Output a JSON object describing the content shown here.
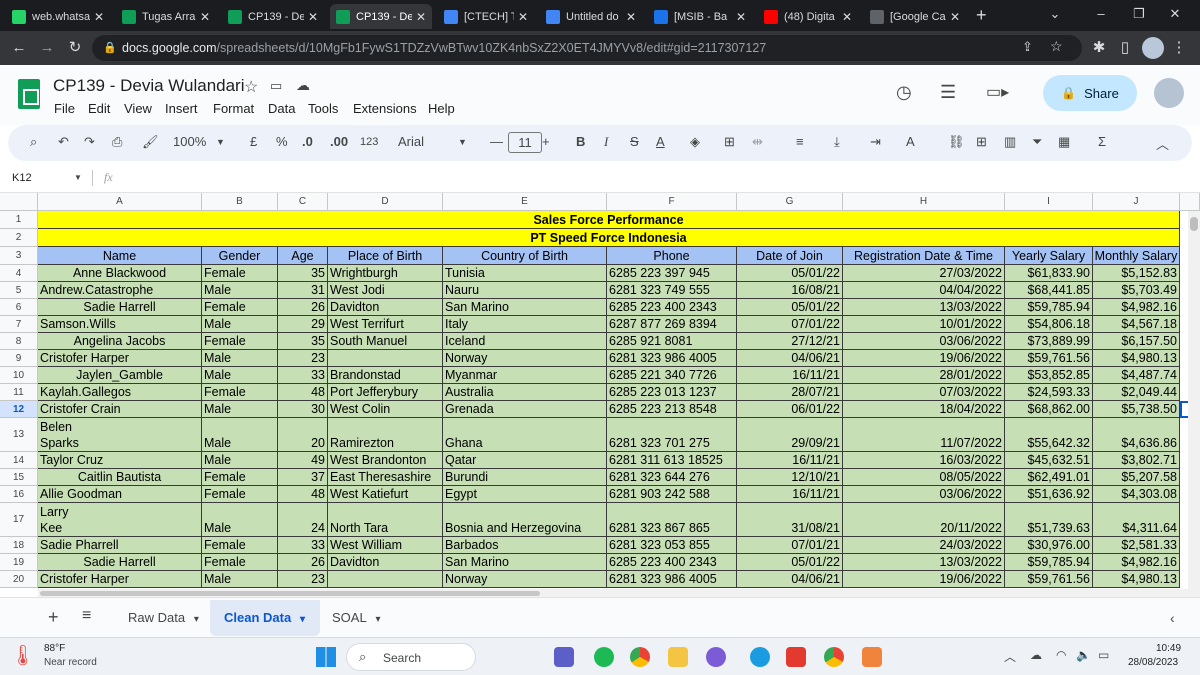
{
  "browser": {
    "tabs": [
      {
        "title": "web.whatsapp",
        "color": "#25d366"
      },
      {
        "title": "Tugas Arra",
        "color": "#0f9d58"
      },
      {
        "title": "CP139 - De",
        "color": "#0f9d58"
      },
      {
        "title": "CP139 - De",
        "color": "#0f9d58"
      },
      {
        "title": "[CTECH] Tu",
        "color": "#4285f4"
      },
      {
        "title": "Untitled do",
        "color": "#4285f4"
      },
      {
        "title": "[MSIB - Ba",
        "color": "#1a73e8"
      },
      {
        "title": "(48) Digita",
        "color": "#ff0000"
      },
      {
        "title": "[Google Ca",
        "color": "#5f6368"
      }
    ],
    "url_host": "docs.google.com",
    "url_path": "/spreadsheets/d/10MgFb1FywS1TDZzVwBTwv10ZK4nbSxZ2X0ET4JMYVv8/edit#gid=2117307127"
  },
  "doc": {
    "title": "CP139 - Devia Wulandari",
    "menu": [
      "File",
      "Edit",
      "View",
      "Insert",
      "Format",
      "Data",
      "Tools",
      "Extensions",
      "Help"
    ],
    "share_label": "Share"
  },
  "toolbar": {
    "zoom": "100%",
    "currency": "£",
    "percent": "%",
    "dec_less": ".0",
    "dec_more": ".00",
    "num_format": "123",
    "font": "Arial",
    "font_size": "11",
    "bold": "B",
    "italic": "I",
    "strike": "S",
    "text_color": "A"
  },
  "formula_bar": {
    "cell_ref": "K12",
    "fx": "fx",
    "value": ""
  },
  "grid": {
    "columns": [
      "A",
      "B",
      "C",
      "D",
      "E",
      "F",
      "G",
      "H",
      "I",
      "J"
    ],
    "row_numbers": [
      "1",
      "2",
      "3",
      "4",
      "5",
      "6",
      "7",
      "8",
      "9",
      "10",
      "11",
      "12",
      "13",
      "14",
      "15",
      "16",
      "17",
      "18",
      "19",
      "20"
    ],
    "banner1": "Sales Force Performance",
    "banner2": "PT Speed Force Indonesia",
    "headers": [
      "Name",
      "Gender",
      "Age",
      "Place of Birth",
      "Country of Birth",
      "Phone",
      "Date of Join",
      "Registration Date & Time",
      "Yearly Salary",
      "Monthly Salary"
    ],
    "rows": [
      [
        "Anne Blackwood",
        "Female",
        "35",
        "Wrightburgh",
        "Tunisia",
        "6285 223 397 945",
        "05/01/22",
        "27/03/2022",
        "$61,833.90",
        "$5,152.83"
      ],
      [
        "Andrew.Catastrophe",
        "Male",
        "31",
        "West Jodi",
        "Nauru",
        "6281 323 749 555",
        "16/08/21",
        "04/04/2022",
        "$68,441.85",
        "$5,703.49"
      ],
      [
        "Sadie    Harrell",
        "Female",
        "26",
        "Davidton",
        "San Marino",
        "6285 223 400 2343",
        "05/01/22",
        "13/03/2022",
        "$59,785.94",
        "$4,982.16"
      ],
      [
        "Samson.Wills",
        "Male",
        "29",
        "West Terrifurt",
        "Italy",
        "6287 877 269 8394",
        "07/01/22",
        "10/01/2022",
        "$54,806.18",
        "$4,567.18"
      ],
      [
        "Angelina Jacobs",
        "Female",
        "35",
        "South Manuel",
        "Iceland",
        "6285 921 8081",
        "27/12/21",
        "03/06/2022",
        "$73,889.99",
        "$6,157.50"
      ],
      [
        "Cristofer Harper",
        "Male",
        "23",
        "",
        "Norway",
        "6281 323 986 4005",
        "04/06/21",
        "19/06/2022",
        "$59,761.56",
        "$4,980.13"
      ],
      [
        "Jaylen_Gamble",
        "Male",
        "33",
        "Brandonstad",
        "Myanmar",
        "6285 221 340 7726",
        "16/11/21",
        "28/01/2022",
        "$53,852.85",
        "$4,487.74"
      ],
      [
        "Kaylah.Gallegos",
        "Female",
        "48",
        "Port Jefferybury",
        "Australia",
        "6285 223 013 1237",
        "28/07/21",
        "07/03/2022",
        "$24,593.33",
        "$2,049.44"
      ],
      [
        "Cristofer Crain",
        "Male",
        "30",
        "West Colin",
        "Grenada",
        "6285 223 213 8548",
        "06/01/22",
        "18/04/2022",
        "$68,862.00",
        "$5,738.50"
      ],
      [
        "Belen\nSparks",
        "Male",
        "20",
        "Ramirezton",
        "Ghana",
        "6281 323 701 275",
        "29/09/21",
        "11/07/2022",
        "$55,642.32",
        "$4,636.86"
      ],
      [
        "Taylor Cruz",
        "Male",
        "49",
        "West Brandonton",
        "Qatar",
        "6281 311 613 18525",
        "16/11/21",
        "16/03/2022",
        "$45,632.51",
        "$3,802.71"
      ],
      [
        "Caitlin Bautista",
        "Female",
        "37",
        "East Theresashire",
        "Burundi",
        "6281 323 644 276",
        "12/10/21",
        "08/05/2022",
        "$62,491.01",
        "$5,207.58"
      ],
      [
        "Allie Goodman",
        "Female",
        "48",
        "West Katiefurt",
        "Egypt",
        "6281 903 242 588",
        "16/11/21",
        "03/06/2022",
        "$51,636.92",
        "$4,303.08"
      ],
      [
        "Larry\nKee",
        "Male",
        "24",
        "North Tara",
        "Bosnia and Herzegovina",
        "6281 323 867 865",
        "31/08/21",
        "20/11/2022",
        "$51,739.63",
        "$4,311.64"
      ],
      [
        "Sadie Pharrell",
        "Female",
        "33",
        "West William",
        "Barbados",
        "6281 323 053 855",
        "07/01/21",
        "24/03/2022",
        "$30,976.00",
        "$2,581.33"
      ],
      [
        "Sadie    Harrell",
        "Female",
        "26",
        "Davidton",
        "San Marino",
        "6285 223 400 2343",
        "05/01/22",
        "13/03/2022",
        "$59,785.94",
        "$4,982.16"
      ],
      [
        "Cristofer Harper",
        "Male",
        "23",
        "",
        "Norway",
        "6281 323 986 4005",
        "04/06/21",
        "19/06/2022",
        "$59,761.56",
        "$4,980.13"
      ]
    ]
  },
  "sheets": {
    "tabs": [
      "Raw Data",
      "Clean Data",
      "SOAL"
    ],
    "active": "Clean Data"
  },
  "taskbar": {
    "temp": "88°F",
    "weather": "Near record",
    "search": "Search",
    "time": "10:49",
    "date": "28/08/2023"
  }
}
